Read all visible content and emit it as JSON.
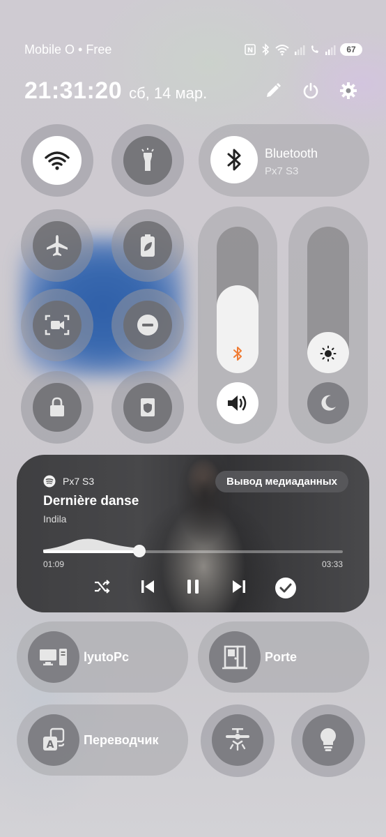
{
  "status_bar": {
    "carrier": "Mobile O • Free",
    "battery": "67",
    "icons": [
      "nfc-icon",
      "bluetooth-icon",
      "wifi-icon",
      "signal-icon",
      "signal-2-icon"
    ]
  },
  "header": {
    "time": "21:31:20",
    "date": "сб, 14 мар.",
    "icons": [
      "edit-icon",
      "power-icon",
      "settings-icon"
    ]
  },
  "quick_tiles": [
    {
      "name": "wifi",
      "icon": "wifi-icon",
      "active": true
    },
    {
      "name": "flashlight",
      "icon": "flashlight-icon",
      "active": false
    },
    {
      "name": "airplane-mode",
      "icon": "airplane-icon",
      "active": false
    },
    {
      "name": "power-saving",
      "icon": "battery-leaf-icon",
      "active": false
    },
    {
      "name": "screen-recorder",
      "icon": "screen-record-icon",
      "active": false
    },
    {
      "name": "do-not-disturb",
      "icon": "minus-circle-icon",
      "active": false
    },
    {
      "name": "lock",
      "icon": "lock-icon",
      "active": false
    },
    {
      "name": "secure-folder",
      "icon": "shield-icon",
      "active": false
    }
  ],
  "bluetooth": {
    "title": "Bluetooth",
    "device": "Px7 S3",
    "active": true
  },
  "sliders": {
    "volume_level": 0.6,
    "brightness_level": 0.28
  },
  "media": {
    "app_icon": "spotify-icon",
    "device": "Px7 S3",
    "output_button": "Вывод медиаданных",
    "title": "Dernière danse",
    "artist": "Indila",
    "elapsed": "01:09",
    "duration": "03:33",
    "progress": 0.32,
    "controls": [
      "shuffle-icon",
      "previous-icon",
      "pause-icon",
      "next-icon",
      "check-icon"
    ]
  },
  "devices": [
    {
      "label": "lyutoPc",
      "icon": "computer-icon"
    },
    {
      "label": "Porte",
      "icon": "door-icon"
    },
    {
      "label": "Переводчик",
      "icon": "translate-icon"
    }
  ],
  "bottom_icons": [
    "ceiling-fan-icon",
    "lightbulb-icon"
  ]
}
